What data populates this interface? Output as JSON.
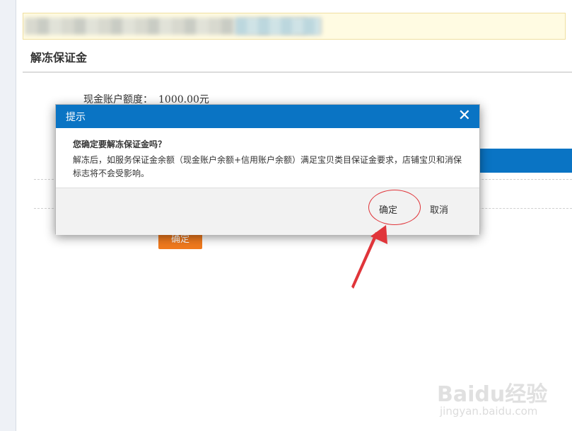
{
  "page": {
    "section_title": "解冻保证金",
    "quota_label": "现金账户额度：",
    "quota_value": "1000.00元",
    "confirm_button": "确定"
  },
  "dialog": {
    "title": "提示",
    "close_icon": "close-icon",
    "question": "您确定要解冻保证金吗？",
    "message": "解冻后，如服务保证金余额（现金账户余额+信用账户余额）满足宝贝类目保证金要求，店铺宝贝和消保标志将不会受影响。",
    "ok_label": "确定",
    "cancel_label": "取消"
  },
  "annotation": {
    "color": "#e0353a"
  },
  "watermark": {
    "brand": "Baidu经验",
    "url": "jingyan.baidu.com"
  },
  "colors": {
    "header_blue": "#0a74c4",
    "orange_button": "#f07a1e",
    "notice_bg": "#fffbe2"
  }
}
